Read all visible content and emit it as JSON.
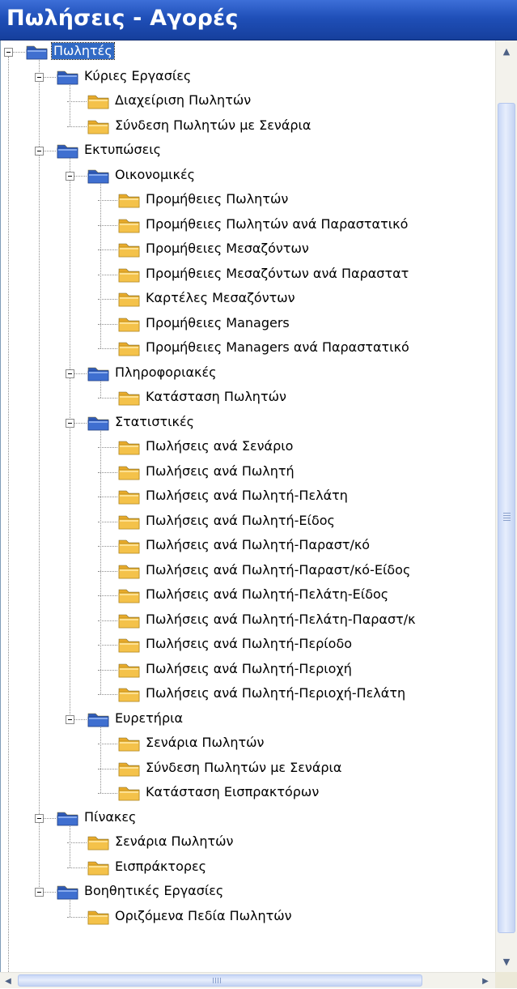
{
  "window": {
    "title": "Πωλήσεις - Αγορές"
  },
  "tree": {
    "nodes": [
      {
        "label": "Πωλητές",
        "depth": 0,
        "icon": "folder-blue-icon",
        "expanded": true,
        "selected": true
      },
      {
        "label": "Κύριες Εργασίες",
        "depth": 1,
        "icon": "folder-blue-icon",
        "expanded": true
      },
      {
        "label": "Διαχείριση Πωλητών",
        "depth": 2,
        "icon": "folder-yellow-icon"
      },
      {
        "label": "Σύνδεση Πωλητών με Σενάρια",
        "depth": 2,
        "icon": "folder-yellow-icon"
      },
      {
        "label": "Εκτυπώσεις",
        "depth": 1,
        "icon": "folder-blue-icon",
        "expanded": true
      },
      {
        "label": "Οικονομικές",
        "depth": 2,
        "icon": "folder-blue-icon",
        "expanded": true
      },
      {
        "label": "Προμήθειες Πωλητών",
        "depth": 3,
        "icon": "folder-yellow-icon"
      },
      {
        "label": "Προμήθειες Πωλητών ανά Παραστατικό",
        "depth": 3,
        "icon": "folder-yellow-icon"
      },
      {
        "label": "Προμήθειες Μεσαζόντων",
        "depth": 3,
        "icon": "folder-yellow-icon"
      },
      {
        "label": "Προμήθειες Μεσαζόντων ανά Παραστατ",
        "depth": 3,
        "icon": "folder-yellow-icon"
      },
      {
        "label": "Καρτέλες Μεσαζόντων",
        "depth": 3,
        "icon": "folder-yellow-icon"
      },
      {
        "label": "Προμήθειες Managers",
        "depth": 3,
        "icon": "folder-yellow-icon"
      },
      {
        "label": "Προμήθειες Managers ανά Παραστατικό",
        "depth": 3,
        "icon": "folder-yellow-icon"
      },
      {
        "label": "Πληροφοριακές",
        "depth": 2,
        "icon": "folder-blue-icon",
        "expanded": true
      },
      {
        "label": "Κατάσταση Πωλητών",
        "depth": 3,
        "icon": "folder-yellow-icon"
      },
      {
        "label": "Στατιστικές",
        "depth": 2,
        "icon": "folder-blue-icon",
        "expanded": true
      },
      {
        "label": "Πωλήσεις ανά Σενάριο",
        "depth": 3,
        "icon": "folder-yellow-icon"
      },
      {
        "label": "Πωλήσεις ανά Πωλητή",
        "depth": 3,
        "icon": "folder-yellow-icon"
      },
      {
        "label": "Πωλήσεις ανά Πωλητή-Πελάτη",
        "depth": 3,
        "icon": "folder-yellow-icon"
      },
      {
        "label": "Πωλήσεις ανά Πωλητή-Είδος",
        "depth": 3,
        "icon": "folder-yellow-icon"
      },
      {
        "label": "Πωλήσεις ανά Πωλητή-Παραστ/κό",
        "depth": 3,
        "icon": "folder-yellow-icon"
      },
      {
        "label": "Πωλήσεις ανά Πωλητή-Παραστ/κό-Είδος",
        "depth": 3,
        "icon": "folder-yellow-icon"
      },
      {
        "label": "Πωλήσεις ανά Πωλητή-Πελάτη-Είδος",
        "depth": 3,
        "icon": "folder-yellow-icon"
      },
      {
        "label": "Πωλήσεις ανά Πωλητή-Πελάτη-Παραστ/κ",
        "depth": 3,
        "icon": "folder-yellow-icon"
      },
      {
        "label": "Πωλήσεις ανά Πωλητή-Περίοδο",
        "depth": 3,
        "icon": "folder-yellow-icon"
      },
      {
        "label": "Πωλήσεις ανά Πωλητή-Περιοχή",
        "depth": 3,
        "icon": "folder-yellow-icon"
      },
      {
        "label": "Πωλήσεις ανά Πωλητή-Περιοχή-Πελάτη",
        "depth": 3,
        "icon": "folder-yellow-icon"
      },
      {
        "label": "Ευρετήρια",
        "depth": 2,
        "icon": "folder-blue-icon",
        "expanded": true
      },
      {
        "label": "Σενάρια Πωλητών",
        "depth": 3,
        "icon": "folder-yellow-icon"
      },
      {
        "label": "Σύνδεση Πωλητών με Σενάρια",
        "depth": 3,
        "icon": "folder-yellow-icon"
      },
      {
        "label": "Κατάσταση Εισπρακτόρων",
        "depth": 3,
        "icon": "folder-yellow-icon"
      },
      {
        "label": "Πίνακες",
        "depth": 1,
        "icon": "folder-blue-icon",
        "expanded": true
      },
      {
        "label": "Σενάρια Πωλητών",
        "depth": 2,
        "icon": "folder-yellow-icon"
      },
      {
        "label": "Εισπράκτορες",
        "depth": 2,
        "icon": "folder-yellow-icon"
      },
      {
        "label": "Βοηθητικές Εργασίες",
        "depth": 1,
        "icon": "folder-blue-icon",
        "expanded": true
      },
      {
        "label": "Οριζόμενα Πεδία Πωλητών",
        "depth": 2,
        "icon": "folder-yellow-icon"
      }
    ]
  },
  "scrollbars": {
    "vertical": {
      "up_icon": "scroll-up-arrow-icon",
      "down_icon": "scroll-down-arrow-icon",
      "thumb_icon": "scroll-grip-icon"
    },
    "horizontal": {
      "left_icon": "scroll-left-arrow-icon",
      "right_icon": "scroll-right-arrow-icon",
      "thumb_icon": "scroll-grip-icon"
    }
  },
  "colors": {
    "title_bar": "#1f4fb8",
    "selection": "#316ac5",
    "folder_blue": "#3f6fd0",
    "folder_yellow": "#f4c24a"
  }
}
